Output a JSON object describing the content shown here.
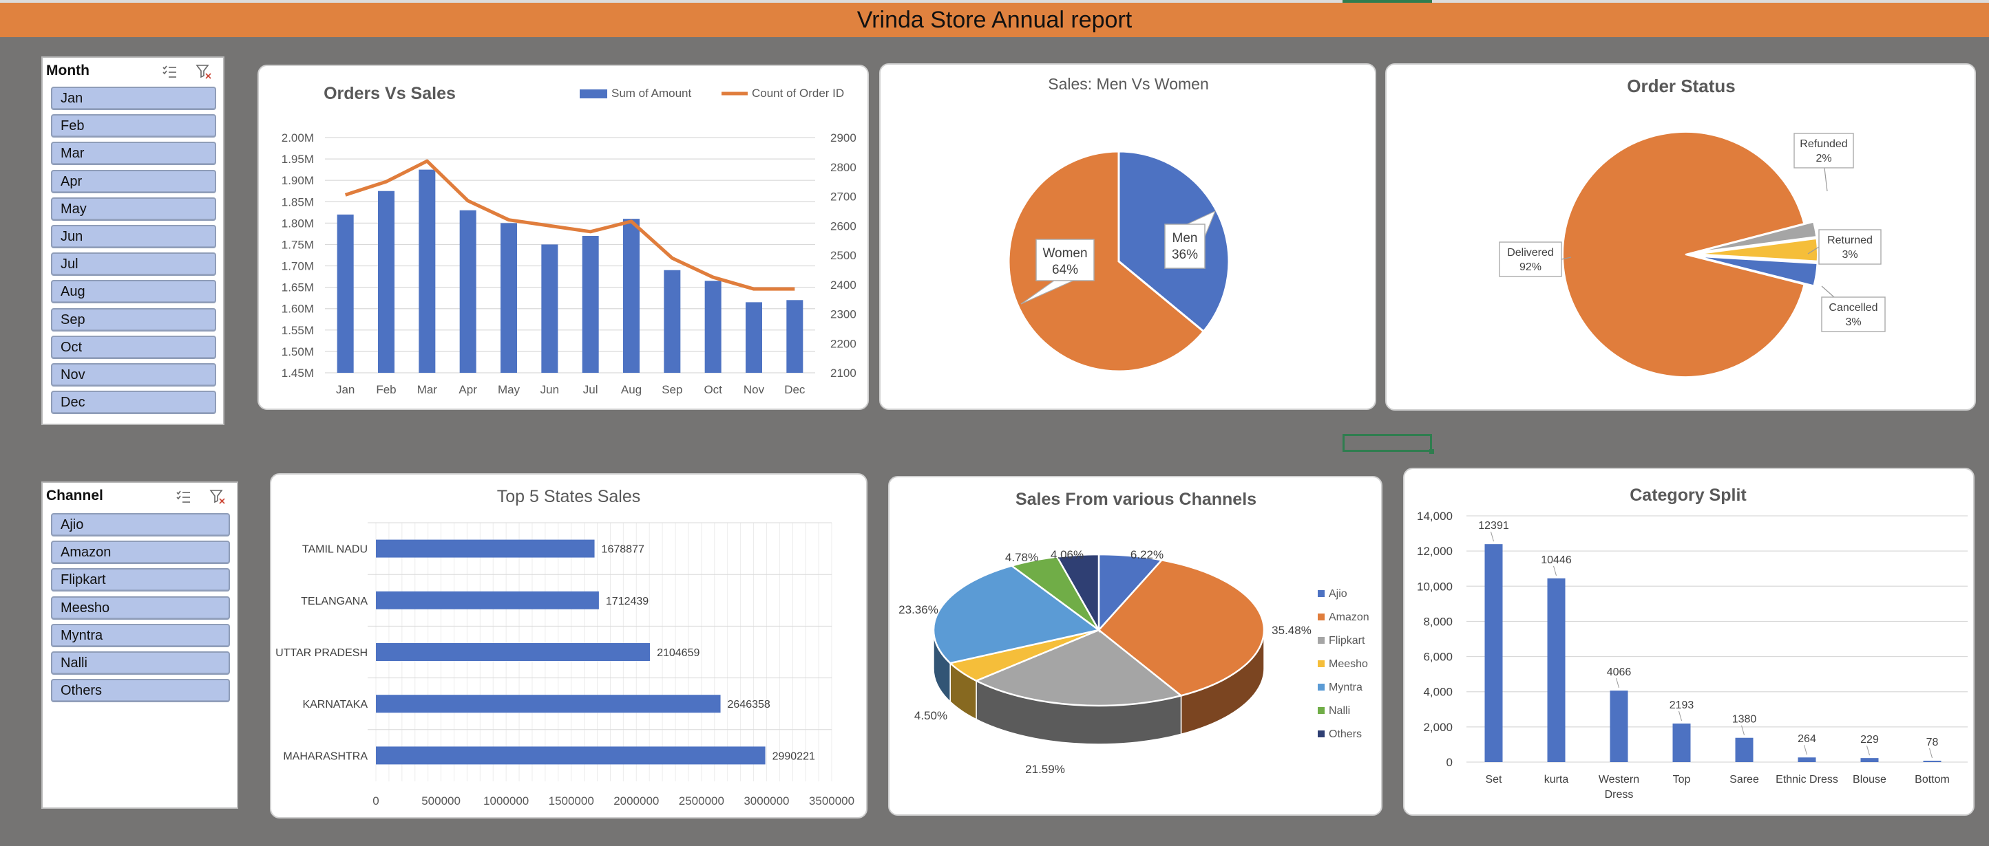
{
  "report": {
    "title": "Vrinda Store Annual report"
  },
  "colors": {
    "blue": "#4d72c2",
    "orange": "#e07d3c",
    "gray": "#a5a5a5",
    "yellow": "#f5be3a",
    "lightblue": "#5b9bd5",
    "green": "#70ad47",
    "navy": "#2f3f73",
    "header": "#e0823f",
    "background": "#757473"
  },
  "slicers": {
    "month": {
      "title": "Month",
      "icons": [
        "multi-select-icon",
        "clear-filter-icon"
      ],
      "items": [
        "Jan",
        "Feb",
        "Mar",
        "Apr",
        "May",
        "Jun",
        "Jul",
        "Aug",
        "Sep",
        "Oct",
        "Nov",
        "Dec"
      ]
    },
    "channel": {
      "title": "Channel",
      "icons": [
        "multi-select-icon",
        "clear-filter-icon"
      ],
      "items": [
        "Ajio",
        "Amazon",
        "Flipkart",
        "Meesho",
        "Myntra",
        "Nalli",
        "Others"
      ]
    }
  },
  "chart_data": [
    {
      "id": "orders_vs_sales",
      "type": "bar",
      "title": "Orders Vs Sales",
      "categories": [
        "Jan",
        "Feb",
        "Mar",
        "Apr",
        "May",
        "Jun",
        "Jul",
        "Aug",
        "Sep",
        "Oct",
        "Nov",
        "Dec"
      ],
      "series": [
        {
          "name": "Sum of Amount",
          "type": "bar",
          "axis": "left",
          "values": [
            1.82,
            1.875,
            1.925,
            1.83,
            1.8,
            1.75,
            1.77,
            1.81,
            1.69,
            1.665,
            1.615,
            1.62
          ]
        },
        {
          "name": "Count of Order ID",
          "type": "line",
          "axis": "right",
          "values": [
            2705,
            2750,
            2820,
            2685,
            2620,
            2600,
            2580,
            2615,
            2490,
            2425,
            2385,
            2385
          ]
        }
      ],
      "y_left": {
        "min": 1.45,
        "max": 2.0,
        "ticks": [
          "1.45M",
          "1.50M",
          "1.55M",
          "1.60M",
          "1.65M",
          "1.70M",
          "1.75M",
          "1.80M",
          "1.85M",
          "1.90M",
          "1.95M",
          "2.00M"
        ]
      },
      "y_right": {
        "min": 2100,
        "max": 2900,
        "ticks": [
          "2100",
          "2200",
          "2300",
          "2400",
          "2500",
          "2600",
          "2700",
          "2800",
          "2900"
        ]
      },
      "legend": "top-right",
      "grid": true
    },
    {
      "id": "men_vs_women",
      "type": "pie",
      "title": "Sales: Men Vs  Women",
      "slices": [
        {
          "label": "Men",
          "value": 36,
          "text": "36%"
        },
        {
          "label": "Women",
          "value": 64,
          "text": "64%"
        }
      ]
    },
    {
      "id": "order_status",
      "type": "pie",
      "title": "Order Status",
      "slices": [
        {
          "label": "Delivered",
          "value": 92,
          "text": "92%"
        },
        {
          "label": "Refunded",
          "value": 2,
          "text": "2%"
        },
        {
          "label": "Returned",
          "value": 3,
          "text": "3%"
        },
        {
          "label": "Cancelled",
          "value": 3,
          "text": "3%"
        }
      ]
    },
    {
      "id": "top5_states",
      "type": "bar",
      "orientation": "horizontal",
      "title": "Top 5 States Sales",
      "categories": [
        "TAMIL NADU",
        "TELANGANA",
        "UTTAR PRADESH",
        "KARNATAKA",
        "MAHARASHTRA"
      ],
      "values": [
        1678877,
        1712439,
        2104659,
        2646358,
        2990221
      ],
      "xlim": [
        0,
        3500000
      ],
      "x_ticks": [
        "0",
        "500000",
        "1000000",
        "1500000",
        "2000000",
        "2500000",
        "3000000",
        "3500000"
      ],
      "grid": true
    },
    {
      "id": "channels",
      "type": "pie",
      "title": "Sales From various Channels",
      "legend": "right",
      "slices": [
        {
          "label": "Ajio",
          "value": 6.22,
          "text": "6.22%"
        },
        {
          "label": "Amazon",
          "value": 35.48,
          "text": "35.48%"
        },
        {
          "label": "Flipkart",
          "value": 21.59,
          "text": "21.59%"
        },
        {
          "label": "Meesho",
          "value": 4.5,
          "text": "4.50%"
        },
        {
          "label": "Myntra",
          "value": 23.36,
          "text": "23.36%"
        },
        {
          "label": "Nalli",
          "value": 4.78,
          "text": "4.78%"
        },
        {
          "label": "Others",
          "value": 4.06,
          "text": "4.06%"
        }
      ]
    },
    {
      "id": "category_split",
      "type": "bar",
      "title": "Category Split",
      "categories": [
        "Set",
        "kurta",
        "Western Dress",
        "Top",
        "Saree",
        "Ethnic Dress",
        "Blouse",
        "Bottom"
      ],
      "values": [
        12391,
        10446,
        4066,
        2193,
        1380,
        264,
        229,
        78
      ],
      "ylim": [
        0,
        14000
      ],
      "y_ticks": [
        "0",
        "2,000",
        "4,000",
        "6,000",
        "8,000",
        "10,000",
        "12,000",
        "14,000"
      ],
      "grid": true
    }
  ]
}
